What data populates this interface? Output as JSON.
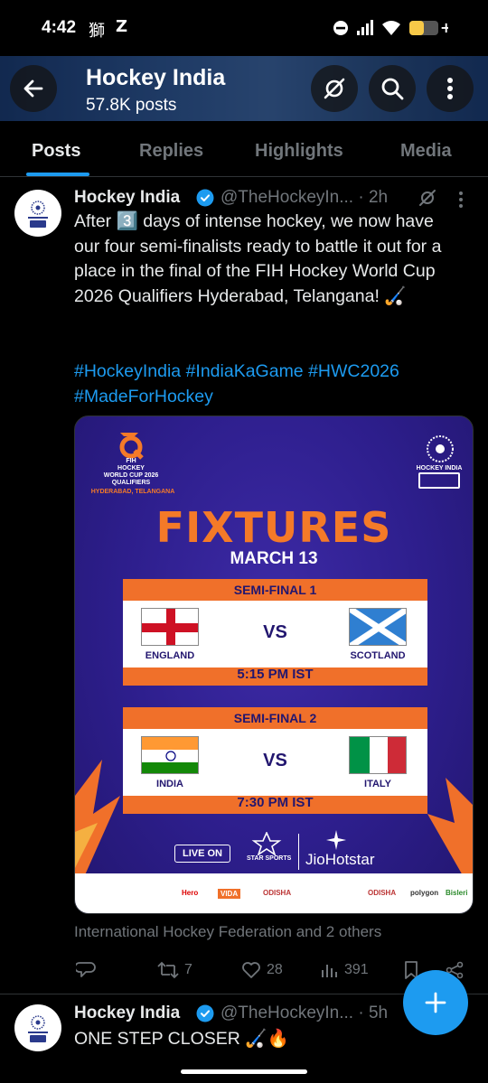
{
  "status_bar": {
    "time": "4:42",
    "noti1": "獅",
    "noti2": "Z"
  },
  "header": {
    "title": "Hockey India",
    "subtitle": "57.8K posts"
  },
  "tabs": [
    {
      "label": "Posts",
      "active": true
    },
    {
      "label": "Replies",
      "active": false
    },
    {
      "label": "Highlights",
      "active": false
    },
    {
      "label": "Media",
      "active": false
    }
  ],
  "post1": {
    "name": "Hockey India",
    "handle_time": "@TheHockeyIn... · 2h",
    "text": "After 3️⃣ days of intense hockey, we now have our four semi-finalists ready to battle it out for a place in the final of the FIH Hockey World Cup 2026 Qualifiers Hyderabad, Telangana! 🏑",
    "hashtags_line1": "#HockeyIndia #IndiaKaGame #HWC2026",
    "hashtags_line2": "#MadeForHockey",
    "others": "International Hockey Federation and 2 others",
    "actions": {
      "reposts": "7",
      "likes": "28",
      "views": "391"
    }
  },
  "poster": {
    "event_lines": [
      "FIH",
      "HOCKEY",
      "WORLD CUP 2026",
      "QUALIFIERS"
    ],
    "location": "HYDERABAD, TELANGANA",
    "hockey_india_label": "HOCKEY INDIA",
    "title": "FIXTURES",
    "date": "MARCH 13",
    "matches": [
      {
        "label": "SEMI-FINAL 1",
        "team1": "ENGLAND",
        "team2": "SCOTLAND",
        "vs": "VS",
        "time": "5:15 PM IST"
      },
      {
        "label": "SEMI-FINAL 2",
        "team1": "INDIA",
        "team2": "ITALY",
        "vs": "VS",
        "time": "7:30 PM IST"
      }
    ],
    "live_on": "LIVE ON",
    "star_sports": "STAR SPORTS",
    "jiohotstar": "JioHotstar",
    "sponsors": [
      "Hero",
      "VIDA",
      "ODISHA",
      "ODISHA",
      "polygon",
      "Bisleri"
    ]
  },
  "post2": {
    "name": "Hockey India",
    "handle_time": "@TheHockeyIn... · 5h",
    "text": "ONE STEP CLOSER 🏑🔥"
  },
  "colors": {
    "accent": "#1d9bf0",
    "poster_bg": "#2d1e8c",
    "poster_orange": "#f0702a"
  }
}
